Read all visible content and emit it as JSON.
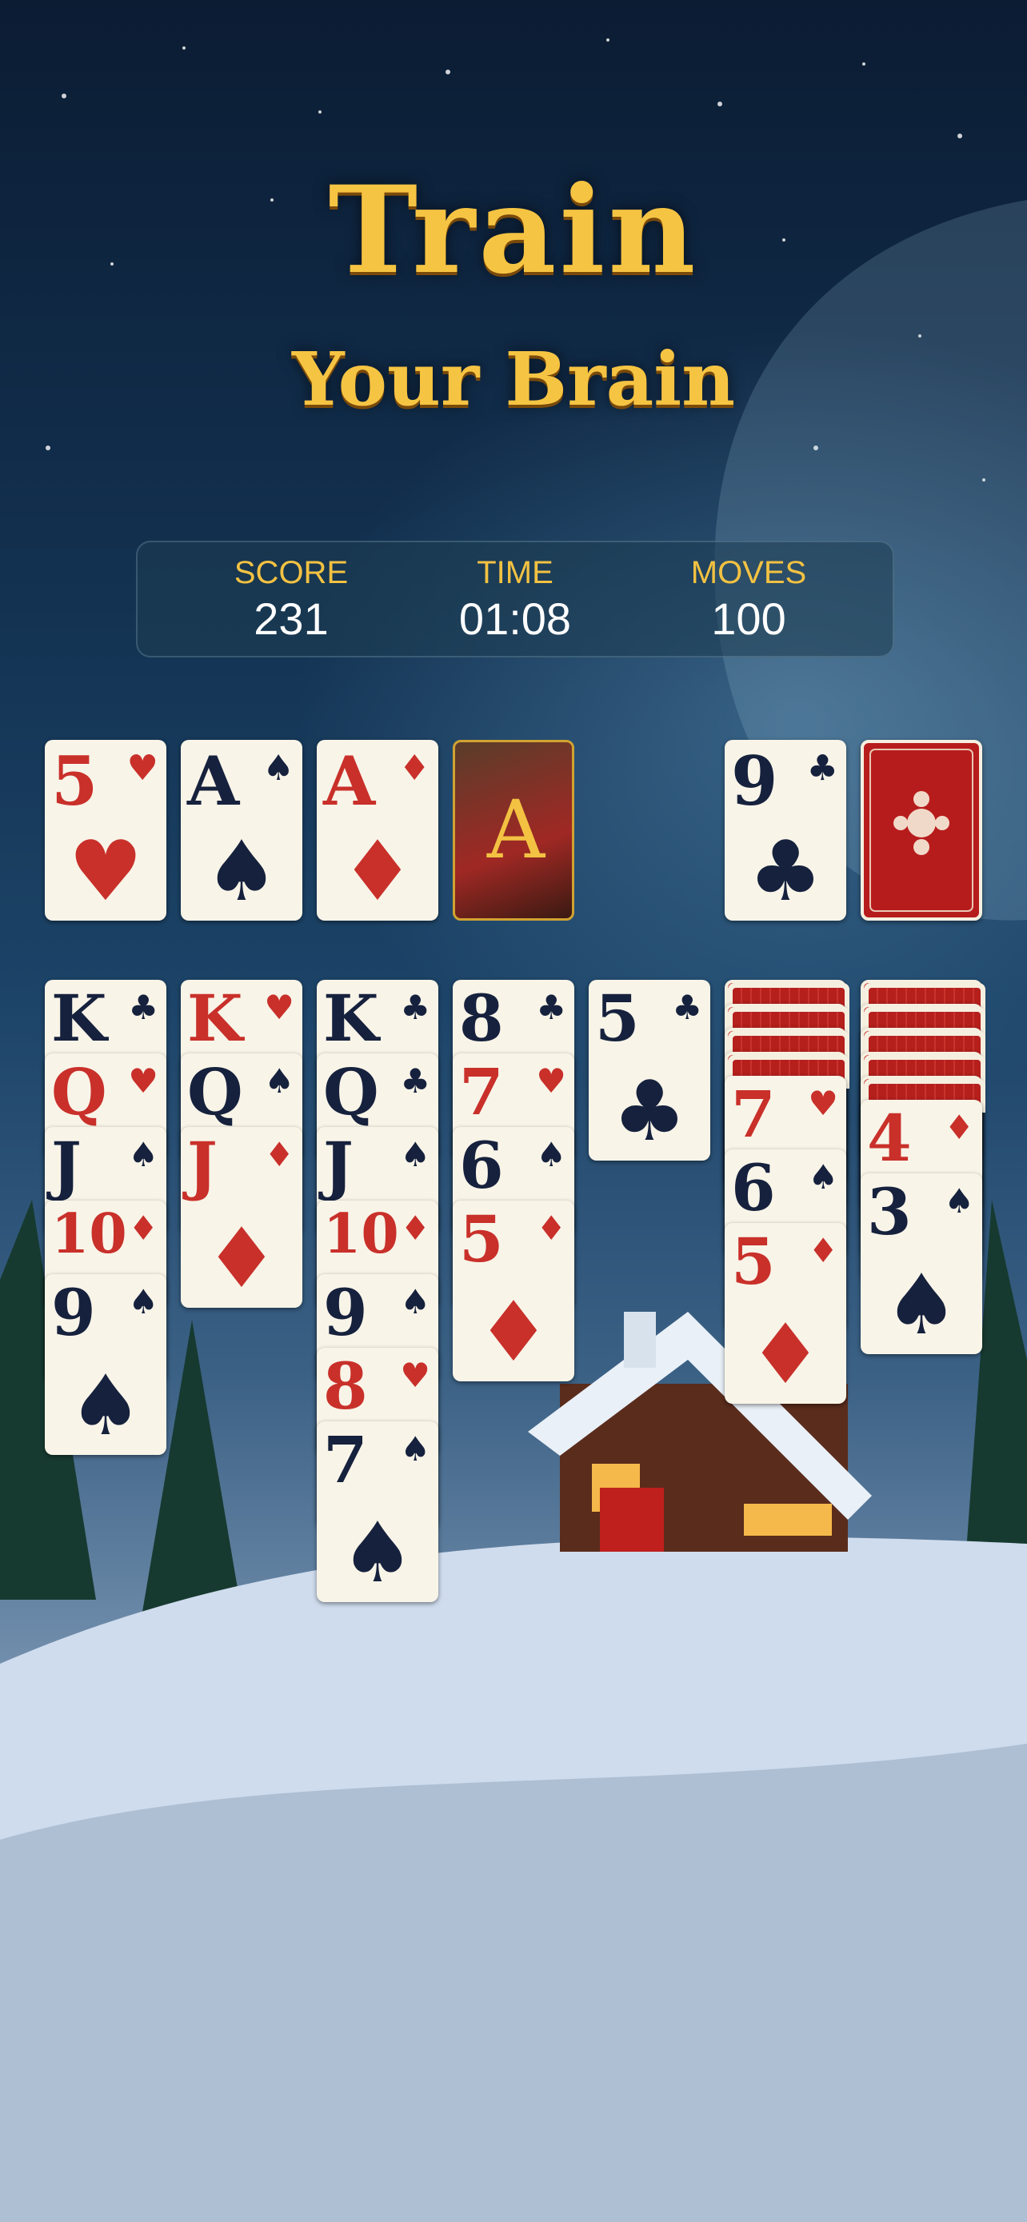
{
  "title": {
    "line1": "Train",
    "line2": "Your Brain"
  },
  "hud": {
    "score_label": "SCORE",
    "score": "231",
    "time_label": "TIME",
    "time": "01:08",
    "moves_label": "MOVES",
    "moves": "100"
  },
  "foundations": [
    {
      "rank": "5",
      "suit": "♥",
      "color": "red"
    },
    {
      "rank": "A",
      "suit": "♠",
      "color": "black"
    },
    {
      "rank": "A",
      "suit": "♦",
      "color": "red"
    },
    {
      "rank": "A",
      "suit": "",
      "color": "gold"
    }
  ],
  "waste": {
    "rank": "9",
    "suit": "♣",
    "color": "black"
  },
  "stock": {
    "label": "card back"
  },
  "tableau": [
    {
      "hidden": 0,
      "cards": [
        [
          "K",
          "♣",
          "black"
        ],
        [
          "Q",
          "♥",
          "red"
        ],
        [
          "J",
          "♠",
          "black"
        ],
        [
          "10",
          "♦",
          "red"
        ],
        [
          "9",
          "♠",
          "black"
        ]
      ]
    },
    {
      "hidden": 0,
      "cards": [
        [
          "K",
          "♥",
          "red"
        ],
        [
          "Q",
          "♠",
          "black"
        ],
        [
          "J",
          "♦",
          "red"
        ]
      ]
    },
    {
      "hidden": 0,
      "cards": [
        [
          "K",
          "♣",
          "black"
        ],
        [
          "Q",
          "♣",
          "black"
        ],
        [
          "J",
          "♠",
          "black"
        ],
        [
          "10",
          "♦",
          "red"
        ],
        [
          "9",
          "♠",
          "black"
        ],
        [
          "8",
          "♥",
          "red"
        ],
        [
          "7",
          "♠",
          "black"
        ]
      ]
    },
    {
      "hidden": 0,
      "cards": [
        [
          "8",
          "♣",
          "black"
        ],
        [
          "7",
          "♥",
          "red"
        ],
        [
          "6",
          "♠",
          "black"
        ],
        [
          "5",
          "♦",
          "red"
        ]
      ]
    },
    {
      "hidden": 0,
      "cards": [
        [
          "5",
          "♣",
          "black"
        ]
      ]
    },
    {
      "hidden": 4,
      "cards": [
        [
          "7",
          "♥",
          "red"
        ],
        [
          "6",
          "♠",
          "black"
        ],
        [
          "5",
          "♦",
          "red"
        ]
      ]
    },
    {
      "hidden": 5,
      "cards": [
        [
          "4",
          "♦",
          "red"
        ],
        [
          "3",
          "♠",
          "black"
        ]
      ]
    }
  ],
  "colors": {
    "gold": "#f6c443",
    "red": "#c9302a",
    "black": "#16213d",
    "card": "#f8f4e8"
  }
}
